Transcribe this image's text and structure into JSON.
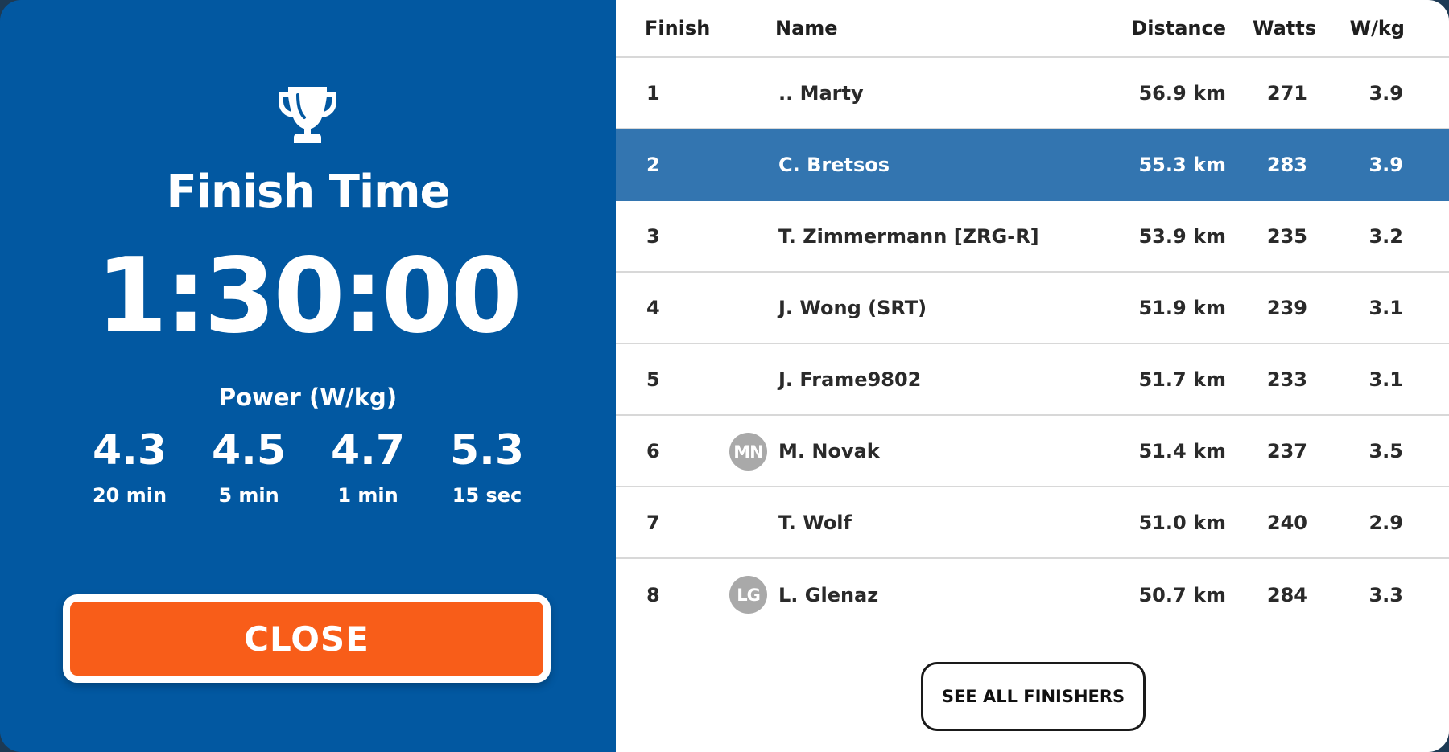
{
  "summary": {
    "finish_label": "Finish Time",
    "finish_time": "1:30:00",
    "power_label": "Power (W/kg)",
    "power": [
      {
        "value": "4.3",
        "period": "20 min"
      },
      {
        "value": "4.5",
        "period": "5 min"
      },
      {
        "value": "4.7",
        "period": "1 min"
      },
      {
        "value": "5.3",
        "period": "15 sec"
      }
    ],
    "close_label": "CLOSE"
  },
  "table": {
    "headers": {
      "finish": "Finish",
      "name": "Name",
      "distance": "Distance",
      "watts": "Watts",
      "wkg": "W/kg"
    },
    "rows": [
      {
        "finish": "1",
        "avatar": "",
        "name": ".. Marty",
        "distance": "56.9 km",
        "watts": "271",
        "wkg": "3.9"
      },
      {
        "finish": "2",
        "avatar": "",
        "name": "C. Bretsos",
        "distance": "55.3 km",
        "watts": "283",
        "wkg": "3.9"
      },
      {
        "finish": "3",
        "avatar": "",
        "name": "T. Zimmermann [ZRG-R]",
        "distance": "53.9 km",
        "watts": "235",
        "wkg": "3.2"
      },
      {
        "finish": "4",
        "avatar": "",
        "name": "J. Wong (SRT)",
        "distance": "51.9 km",
        "watts": "239",
        "wkg": "3.1"
      },
      {
        "finish": "5",
        "avatar": "",
        "name": "J. Frame9802",
        "distance": "51.7 km",
        "watts": "233",
        "wkg": "3.1"
      },
      {
        "finish": "6",
        "avatar": "MN",
        "name": "M. Novak",
        "distance": "51.4 km",
        "watts": "237",
        "wkg": "3.5"
      },
      {
        "finish": "7",
        "avatar": "",
        "name": "T. Wolf",
        "distance": "51.0 km",
        "watts": "240",
        "wkg": "2.9"
      },
      {
        "finish": "8",
        "avatar": "LG",
        "name": "L. Glenaz",
        "distance": "50.7 km",
        "watts": "284",
        "wkg": "3.3"
      }
    ],
    "highlighted_finish": "2",
    "see_all_label": "SEE ALL FINISHERS"
  },
  "icons": {
    "trophy": "trophy-icon"
  },
  "colors": {
    "left_panel": "#0258a1",
    "highlight_row": "#3375b0",
    "close_button": "#f85d19",
    "avatar": "#a9a9a9"
  }
}
